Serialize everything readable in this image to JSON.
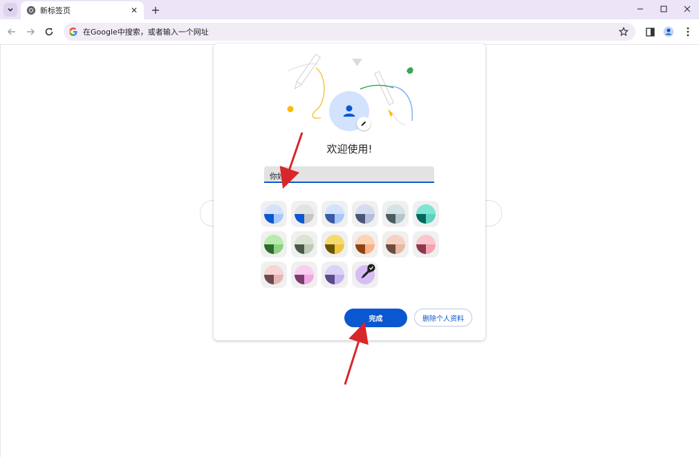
{
  "browser": {
    "tab_title": "新标签页",
    "new_tab_symbol": "+",
    "omnibox_placeholder": "在Google中搜索，或者输入一个网址"
  },
  "dialog": {
    "welcome_text": "欢迎使用!",
    "name_value": "你好",
    "done_label": "完成",
    "delete_label": "删除个人资料",
    "selected_swatch_index": 15
  },
  "swatches": [
    {
      "bg": "#d3e3fd",
      "dark": "#0b57d0",
      "mid": "#a8c7fa"
    },
    {
      "bg": "#e3e3e3",
      "dark": "#0b57d0",
      "mid": "#c4c4c4"
    },
    {
      "bg": "#d3e3fd",
      "dark": "#3b5ba9",
      "mid": "#a8c7fa"
    },
    {
      "bg": "#d5dcef",
      "dark": "#4a5579",
      "mid": "#b4bfd9"
    },
    {
      "bg": "#d6e3e6",
      "dark": "#4d5b5f",
      "mid": "#b5c5c9"
    },
    {
      "bg": "#7fe5d5",
      "dark": "#00695c",
      "mid": "#5ed1bf"
    },
    {
      "bg": "#b7ecab",
      "dark": "#2e6a2b",
      "mid": "#8fd182"
    },
    {
      "bg": "#d9e4d4",
      "dark": "#4b5a46",
      "mid": "#bccab6"
    },
    {
      "bg": "#f8d96b",
      "dark": "#6a5400",
      "mid": "#edc443"
    },
    {
      "bg": "#fdd3b5",
      "dark": "#8b4513",
      "mid": "#f9b384"
    },
    {
      "bg": "#f5d3c3",
      "dark": "#6d4c41",
      "mid": "#e8b8a2"
    },
    {
      "bg": "#fbc6cd",
      "dark": "#8c3a4b",
      "mid": "#f5a3b0"
    },
    {
      "bg": "#f7d5d5",
      "dark": "#6b4c4c",
      "mid": "#e8b5b5"
    },
    {
      "bg": "#fbcdf0",
      "dark": "#7b3c6e",
      "mid": "#f0a8e0"
    },
    {
      "bg": "#dcd1f7",
      "dark": "#5a4a8c",
      "mid": "#c3b3ee"
    },
    {
      "bg": "#d7bdf5",
      "dark": "#6c4a9e",
      "mid": "#c4a3ee"
    }
  ]
}
